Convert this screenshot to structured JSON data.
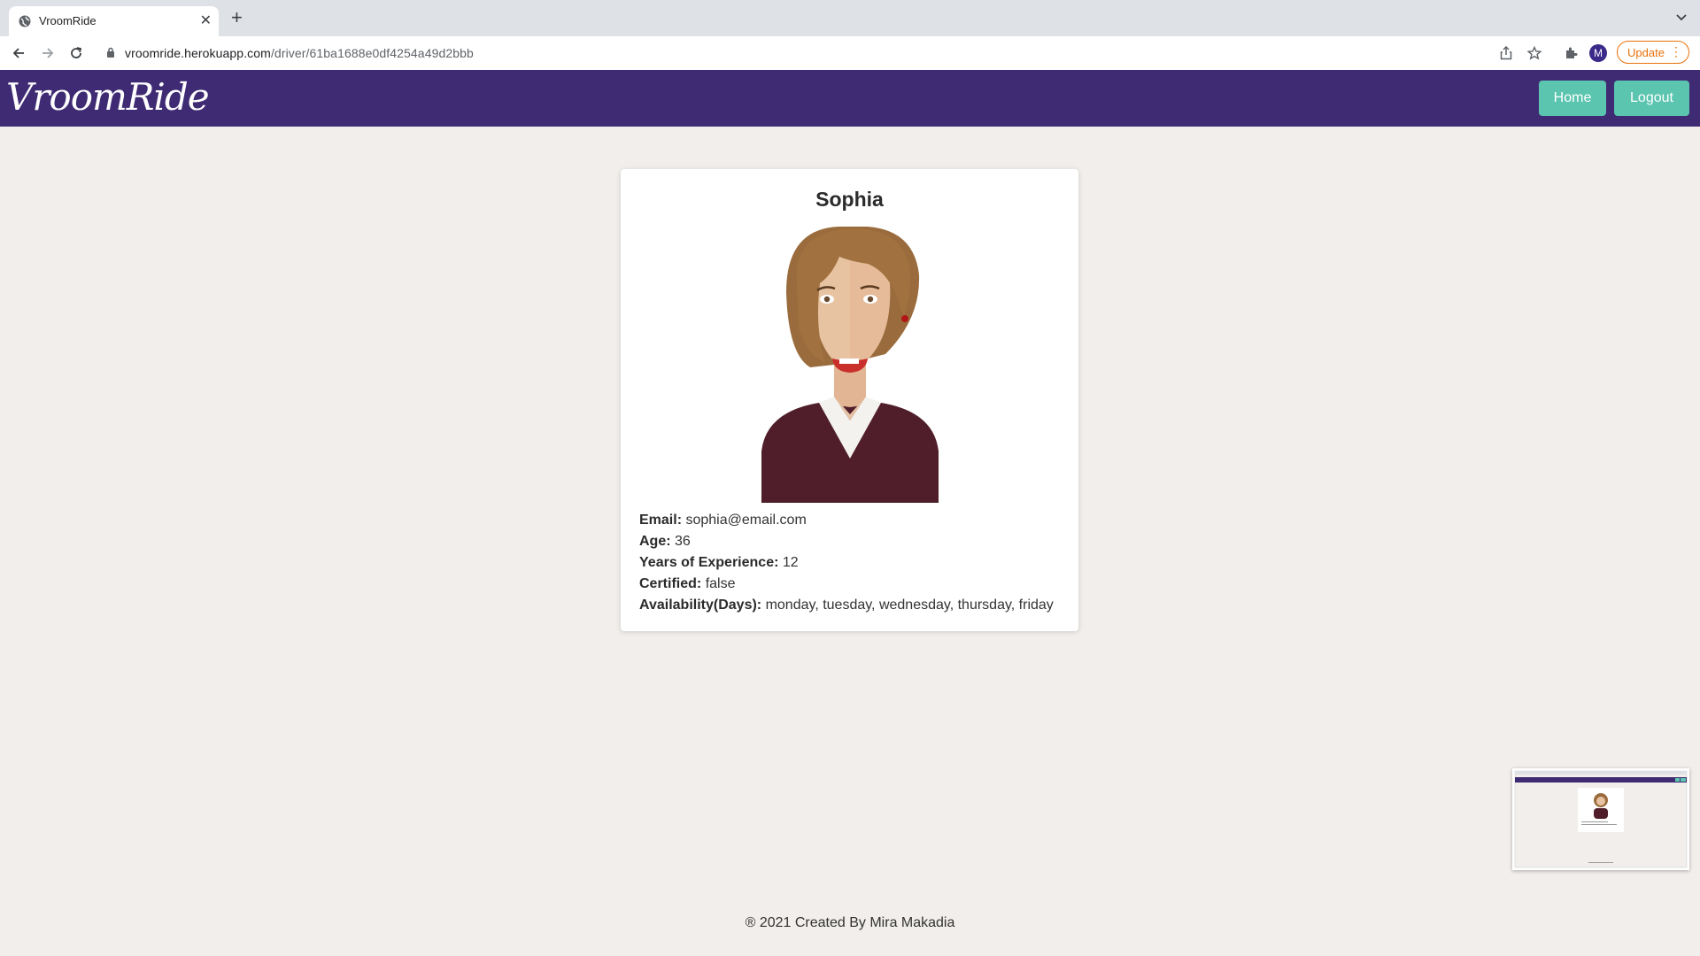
{
  "browser": {
    "tab_title": "VroomRide",
    "url_host": "vroomride.herokuapp.com",
    "url_path": "/driver/61ba1688e0df4254a49d2bbb",
    "profile_initial": "M",
    "update_label": "Update"
  },
  "navbar": {
    "brand": "VroomRide",
    "home_label": "Home",
    "logout_label": "Logout"
  },
  "driver": {
    "name": "Sophia",
    "fields": [
      {
        "label": "Email:",
        "value": "sophia@email.com"
      },
      {
        "label": "Age:",
        "value": "36"
      },
      {
        "label": "Years of Experience:",
        "value": "12"
      },
      {
        "label": "Certified:",
        "value": "false"
      },
      {
        "label": "Availability(Days):",
        "value": "monday, tuesday, wednesday, thursday, friday"
      }
    ]
  },
  "footer": {
    "text": "® 2021 Created By Mira Makadia"
  },
  "colors": {
    "navbar": "#3f2b73",
    "button": "#5bc5b0",
    "page_bg": "#f1eeeb"
  }
}
